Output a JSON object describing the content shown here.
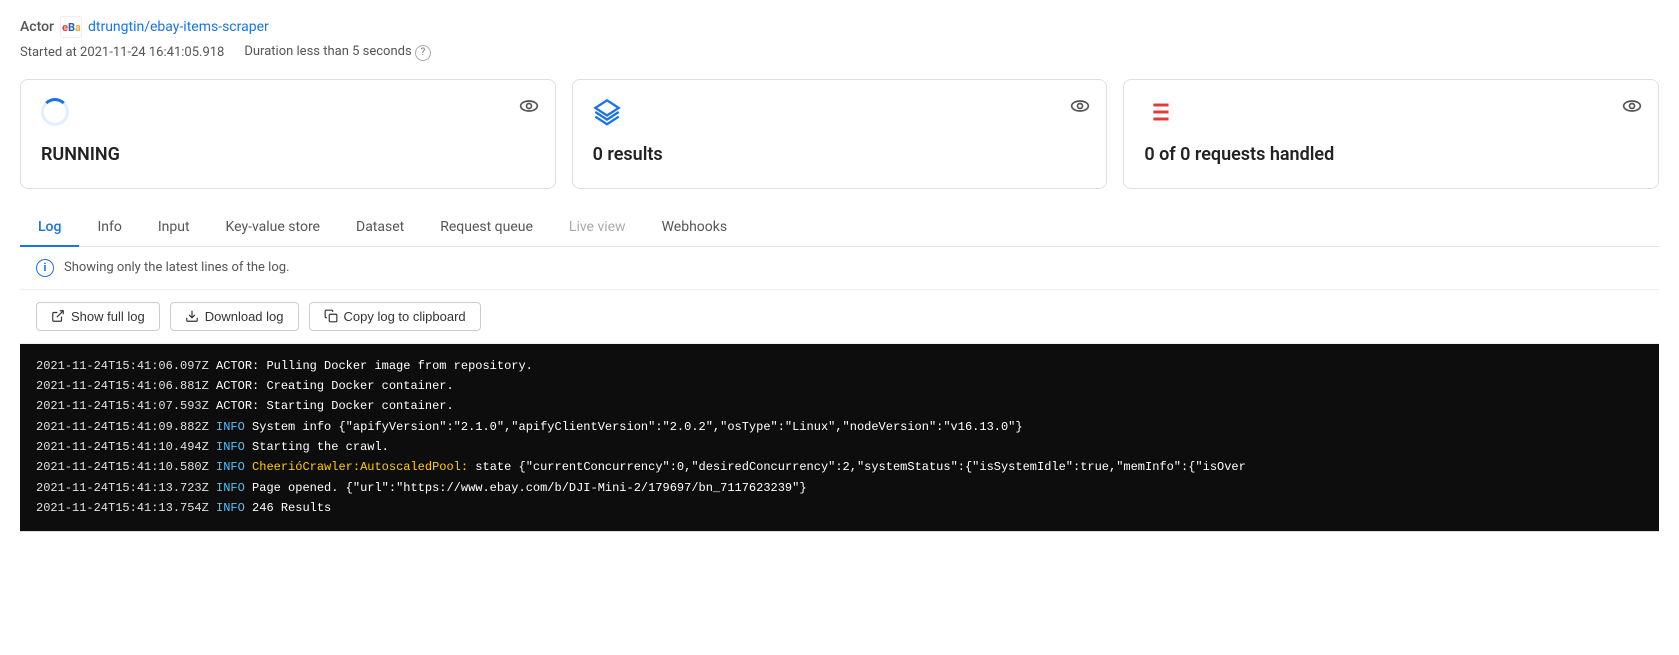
{
  "header": {
    "actor_label": "Actor",
    "actor_name": "dtrungtin/ebay-items-scraper",
    "started_at": "Started at 2021-11-24 16:41:05.918",
    "duration": "Duration less than 5 seconds"
  },
  "cards": [
    {
      "id": "status",
      "value": "RUNNING",
      "icon_type": "spinner"
    },
    {
      "id": "results",
      "value": "0 results",
      "icon_type": "layers"
    },
    {
      "id": "requests",
      "value": "0 of 0 requests handled",
      "icon_type": "list"
    }
  ],
  "tabs": [
    {
      "id": "log",
      "label": "Log",
      "active": true
    },
    {
      "id": "info",
      "label": "Info",
      "active": false
    },
    {
      "id": "input",
      "label": "Input",
      "active": false
    },
    {
      "id": "kv-store",
      "label": "Key-value store",
      "active": false
    },
    {
      "id": "dataset",
      "label": "Dataset",
      "active": false
    },
    {
      "id": "request-queue",
      "label": "Request queue",
      "active": false
    },
    {
      "id": "live-view",
      "label": "Live view",
      "active": false,
      "disabled": true
    },
    {
      "id": "webhooks",
      "label": "Webhooks",
      "active": false
    }
  ],
  "log": {
    "info_banner": "Showing only the latest lines of the log.",
    "buttons": {
      "show_full": "Show full log",
      "download": "Download log",
      "copy": "Copy log to clipboard"
    },
    "lines": [
      {
        "time": "2021-11-24T15:41:06.097Z",
        "level": null,
        "text": "ACTOR: Pulling Docker image from repository."
      },
      {
        "time": "2021-11-24T15:41:06.881Z",
        "level": null,
        "text": "ACTOR: Creating Docker container."
      },
      {
        "time": "2021-11-24T15:41:07.593Z",
        "level": null,
        "text": "ACTOR: Starting Docker container."
      },
      {
        "time": "2021-11-24T15:41:09.882Z",
        "level": "INFO",
        "text": " System info {\"apifyVersion\":\"2.1.0\",\"apifyClientVersion\":\"2.0.2\",\"osType\":\"Linux\",\"nodeVersion\":\"v16.13.0\"}"
      },
      {
        "time": "2021-11-24T15:41:10.494Z",
        "level": "INFO",
        "text": " Starting the crawl."
      },
      {
        "time": "2021-11-24T15:41:10.580Z",
        "level": "INFO",
        "text": " CheerióCrawler:AutoscaledPool: state {\"currentConcurrency\":0,\"desiredConcurrency\":2,\"systemStatus\":{\"isSystemIdle\":true,\"memInfo\":{\"isOver"
      },
      {
        "time": "2021-11-24T15:41:13.723Z",
        "level": "INFO",
        "text": " Page opened. {\"url\":\"https://www.ebay.com/b/DJI-Mini-2/179697/bn_7117623239\"}"
      },
      {
        "time": "2021-11-24T15:41:13.754Z",
        "level": "INFO",
        "text": " 246 Results"
      }
    ]
  }
}
